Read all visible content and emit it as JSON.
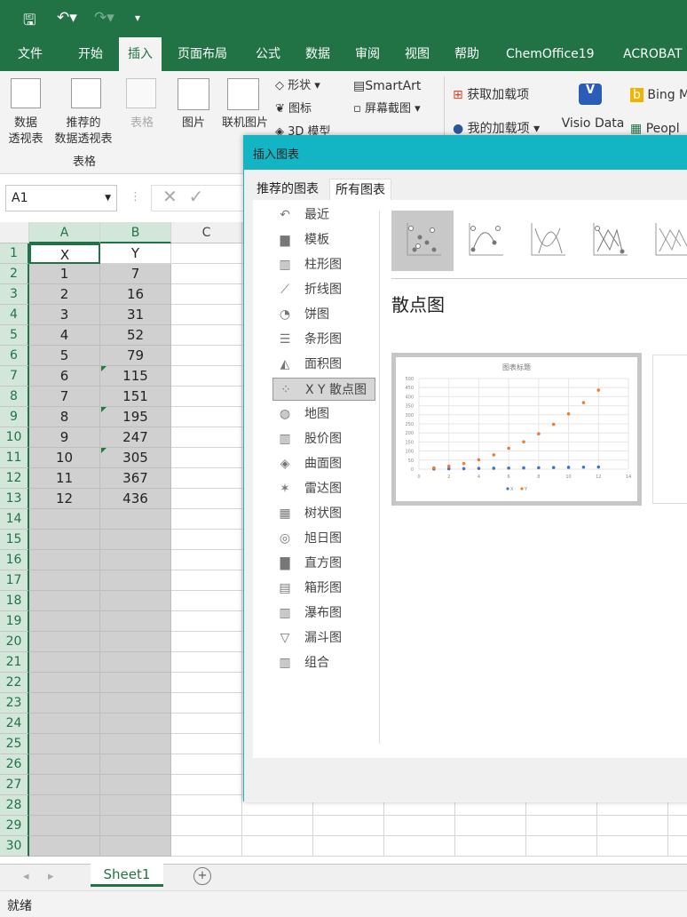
{
  "qat": {
    "save_icon": "save-icon",
    "undo_icon": "undo-icon",
    "redo_icon": "redo-icon",
    "customize_icon": "customize-icon"
  },
  "tabs": [
    "文件",
    "开始",
    "插入",
    "页面布局",
    "公式",
    "数据",
    "审阅",
    "视图",
    "帮助",
    "ChemOffice19",
    "ACROBAT"
  ],
  "active_tab": "插入",
  "ribbon": {
    "pivot": "数据\n透视表",
    "rec_pivot": "推荐的\n数据透视表",
    "table": "表格",
    "group_tables": "表格",
    "picture": "图片",
    "online_picture": "联机图片",
    "shapes": "形状",
    "icons": "图标",
    "3d": "3D 模型",
    "smartart": "SmartArt",
    "screenshot": "屏幕截图",
    "get_addins": "获取加载项",
    "my_addins": "我的加载项",
    "visio": "Visio Data",
    "bing": "Bing M",
    "people": "Peopl"
  },
  "namebox": "A1",
  "columns": [
    "A",
    "B",
    "C"
  ],
  "rows": 30,
  "cells": [
    [
      "X",
      "Y"
    ],
    [
      "1",
      "7"
    ],
    [
      "2",
      "16"
    ],
    [
      "3",
      "31"
    ],
    [
      "4",
      "52"
    ],
    [
      "5",
      "79"
    ],
    [
      "6",
      "115"
    ],
    [
      "7",
      "151"
    ],
    [
      "8",
      "195"
    ],
    [
      "9",
      "247"
    ],
    [
      "10",
      "305"
    ],
    [
      "11",
      "367"
    ],
    [
      "12",
      "436"
    ]
  ],
  "sheet_tab": "Sheet1",
  "status": "就绪",
  "dialog": {
    "title": "插入图表",
    "tabs": [
      "推荐的图表",
      "所有图表"
    ],
    "active_tab": "所有图表",
    "types": [
      "最近",
      "模板",
      "柱形图",
      "折线图",
      "饼图",
      "条形图",
      "面积图",
      "X Y 散点图",
      "地图",
      "股价图",
      "曲面图",
      "雷达图",
      "树状图",
      "旭日图",
      "直方图",
      "箱形图",
      "瀑布图",
      "漏斗图",
      "组合"
    ],
    "icons": [
      "↶",
      "▆",
      "▥",
      "⟋",
      "◔",
      "☰",
      "◭",
      "⁘",
      "◍",
      "▥",
      "◈",
      "✶",
      "▦",
      "◎",
      "▇",
      "▤",
      "▥",
      "▽",
      "▥"
    ],
    "active_type": "X Y 散点图",
    "subtype_heading": "散点图",
    "preview": {
      "title": "图表标题",
      "x": [
        1,
        2,
        3,
        4,
        5,
        6,
        7,
        8,
        9,
        10,
        11,
        12
      ],
      "series": [
        {
          "name": "X",
          "color": "#4472c4",
          "values": [
            1,
            2,
            3,
            4,
            5,
            6,
            7,
            8,
            9,
            10,
            11,
            12
          ]
        },
        {
          "name": "Y",
          "color": "#ed7d31",
          "values": [
            7,
            16,
            31,
            52,
            79,
            115,
            151,
            195,
            247,
            305,
            367,
            436
          ]
        }
      ],
      "xlim": [
        0,
        14
      ],
      "ylim": [
        0,
        500
      ],
      "xticks": [
        0,
        2,
        4,
        6,
        8,
        10,
        12,
        14
      ],
      "yticks": [
        0,
        50,
        100,
        150,
        200,
        250,
        300,
        350,
        400,
        450,
        500
      ]
    }
  },
  "colors": {
    "excel_green": "#217346",
    "dialog_accent": "#13b5c4"
  }
}
